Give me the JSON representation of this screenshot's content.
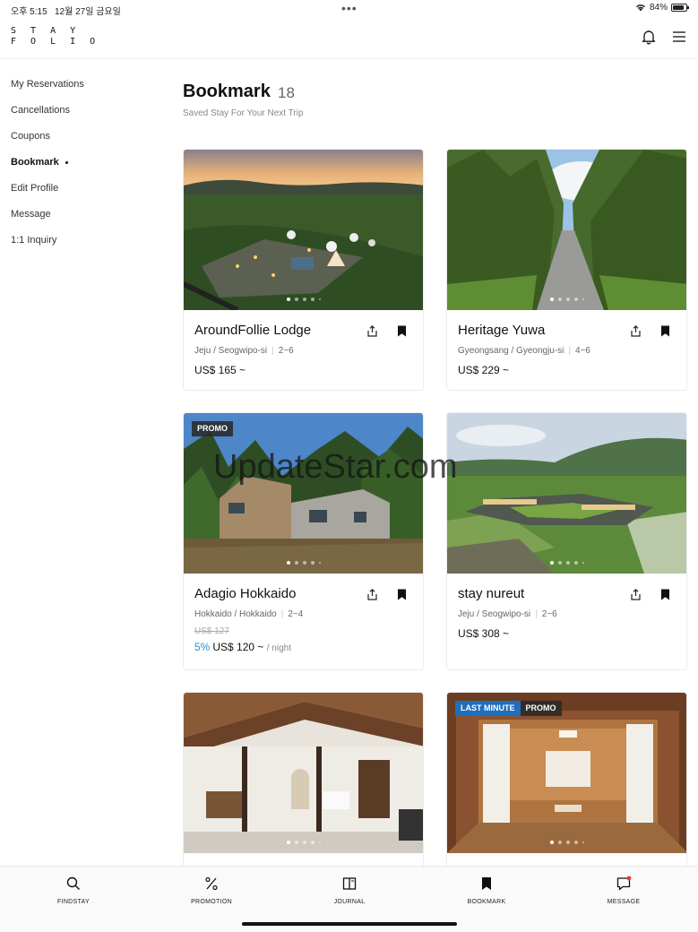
{
  "status": {
    "time": "오후 5:15",
    "date": "12월 27일 금요일",
    "battery": "84%",
    "battery_level": 0.84
  },
  "header": {
    "logo_line1": "S T A Y",
    "logo_line2": "F O L I O",
    "bell_icon": "bell-icon",
    "menu_icon": "hamburger-menu-icon"
  },
  "sidebar": {
    "items": [
      {
        "label": "My Reservations"
      },
      {
        "label": "Cancellations"
      },
      {
        "label": "Coupons"
      },
      {
        "label": "Bookmark",
        "active": true
      },
      {
        "label": "Edit Profile"
      },
      {
        "label": "Message"
      },
      {
        "label": "1:1 Inquiry"
      }
    ]
  },
  "page": {
    "title": "Bookmark",
    "count": "18",
    "subtitle": "Saved Stay For Your Next Trip"
  },
  "cards": [
    {
      "name": "AroundFollie Lodge",
      "region": "Jeju / Seogwipo-si",
      "guests": "2~6",
      "price": "US$ 165 ~"
    },
    {
      "name": "Heritage Yuwa",
      "region": "Gyeongsang / Gyeongju-si",
      "guests": "4~6",
      "price": "US$ 229 ~"
    },
    {
      "name": "Adagio Hokkaido",
      "region": "Hokkaido / Hokkaido",
      "guests": "2~4",
      "old_price": "US$ 127",
      "discount": "5%",
      "price": "US$ 120 ~",
      "unit": "/ night",
      "badges": [
        "PROMO"
      ]
    },
    {
      "name": "stay nureut",
      "region": "Jeju / Seogwipo-si",
      "guests": "2~6",
      "price": "US$ 308 ~"
    },
    {
      "badges": []
    },
    {
      "badges": [
        "LAST MINUTE",
        "PROMO"
      ]
    }
  ],
  "bottom_nav": [
    {
      "label": "FINDSTAY",
      "icon": "search-icon"
    },
    {
      "label": "PROMOTION",
      "icon": "percent-icon"
    },
    {
      "label": "JOURNAL",
      "icon": "book-icon"
    },
    {
      "label": "BOOKMARK",
      "icon": "bookmark-icon",
      "active": true
    },
    {
      "label": "MESSAGE",
      "icon": "chat-icon",
      "has_notification": true
    }
  ],
  "watermark": "UpdateStar.com",
  "colors": {
    "accent_discount": "#2a8fd4",
    "last_minute_badge": "#1f6fbf",
    "notification_dot": "#e53935"
  }
}
